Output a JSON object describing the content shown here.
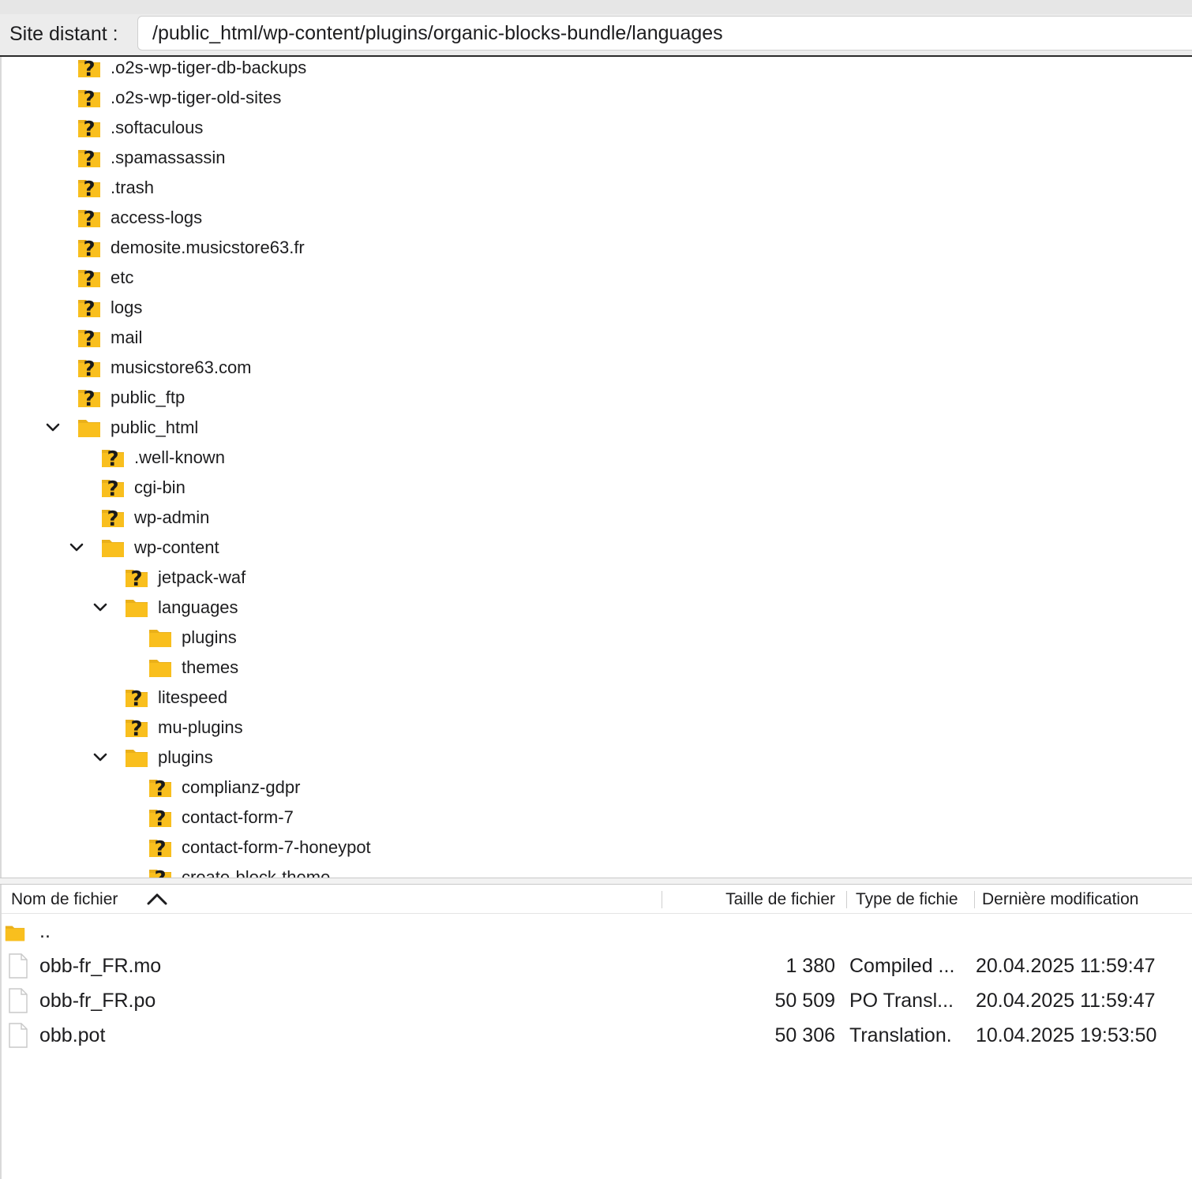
{
  "path_bar": {
    "label": "Site distant :",
    "path": "/public_html/wp-content/plugins/organic-blocks-bundle/languages"
  },
  "tree": [
    {
      "label": ".o2s-wp-tiger-db-backups",
      "level": 0,
      "icon": "unknown-folder-icon",
      "expanded": null
    },
    {
      "label": ".o2s-wp-tiger-old-sites",
      "level": 0,
      "icon": "unknown-folder-icon",
      "expanded": null
    },
    {
      "label": ".softaculous",
      "level": 0,
      "icon": "unknown-folder-icon",
      "expanded": null
    },
    {
      "label": ".spamassassin",
      "level": 0,
      "icon": "unknown-folder-icon",
      "expanded": null
    },
    {
      "label": ".trash",
      "level": 0,
      "icon": "unknown-folder-icon",
      "expanded": null
    },
    {
      "label": "access-logs",
      "level": 0,
      "icon": "unknown-folder-icon",
      "expanded": null
    },
    {
      "label": "demosite.musicstore63.fr",
      "level": 0,
      "icon": "unknown-folder-icon",
      "expanded": null
    },
    {
      "label": "etc",
      "level": 0,
      "icon": "unknown-folder-icon",
      "expanded": null
    },
    {
      "label": "logs",
      "level": 0,
      "icon": "unknown-folder-icon",
      "expanded": null
    },
    {
      "label": "mail",
      "level": 0,
      "icon": "unknown-folder-icon",
      "expanded": null
    },
    {
      "label": "musicstore63.com",
      "level": 0,
      "icon": "unknown-folder-icon",
      "expanded": null
    },
    {
      "label": "public_ftp",
      "level": 0,
      "icon": "unknown-folder-icon",
      "expanded": null
    },
    {
      "label": "public_html",
      "level": 0,
      "icon": "folder-icon",
      "expanded": true
    },
    {
      "label": ".well-known",
      "level": 1,
      "icon": "unknown-folder-icon",
      "expanded": null
    },
    {
      "label": "cgi-bin",
      "level": 1,
      "icon": "unknown-folder-icon",
      "expanded": null
    },
    {
      "label": "wp-admin",
      "level": 1,
      "icon": "unknown-folder-icon",
      "expanded": null
    },
    {
      "label": "wp-content",
      "level": 1,
      "icon": "folder-icon",
      "expanded": true
    },
    {
      "label": "jetpack-waf",
      "level": 2,
      "icon": "unknown-folder-icon",
      "expanded": null
    },
    {
      "label": "languages",
      "level": 2,
      "icon": "folder-icon",
      "expanded": true
    },
    {
      "label": "plugins",
      "level": 3,
      "icon": "folder-icon",
      "expanded": null
    },
    {
      "label": "themes",
      "level": 3,
      "icon": "folder-icon",
      "expanded": null
    },
    {
      "label": "litespeed",
      "level": 2,
      "icon": "unknown-folder-icon",
      "expanded": null
    },
    {
      "label": "mu-plugins",
      "level": 2,
      "icon": "unknown-folder-icon",
      "expanded": null
    },
    {
      "label": "plugins",
      "level": 2,
      "icon": "folder-icon",
      "expanded": true
    },
    {
      "label": "complianz-gdpr",
      "level": 3,
      "icon": "unknown-folder-icon",
      "expanded": null
    },
    {
      "label": "contact-form-7",
      "level": 3,
      "icon": "unknown-folder-icon",
      "expanded": null
    },
    {
      "label": "contact-form-7-honeypot",
      "level": 3,
      "icon": "unknown-folder-icon",
      "expanded": null
    },
    {
      "label": "create-block-theme",
      "level": 3,
      "icon": "unknown-folder-icon",
      "expanded": null
    }
  ],
  "file_list": {
    "columns": {
      "name": "Nom de fichier",
      "size": "Taille de fichier",
      "type": "Type de fichie",
      "modified": "Dernière modification"
    },
    "sort_icon": "chevron-up-icon",
    "rows": [
      {
        "name": "..",
        "size": "",
        "type": "",
        "modified": "",
        "icon": "folder-icon"
      },
      {
        "name": "obb-fr_FR.mo",
        "size": "1 380",
        "type": "Compiled ...",
        "modified": "20.04.2025 11:59:47",
        "icon": "file-icon"
      },
      {
        "name": "obb-fr_FR.po",
        "size": "50 509",
        "type": "PO Transl...",
        "modified": "20.04.2025 11:59:47",
        "icon": "file-icon"
      },
      {
        "name": "obb.pot",
        "size": "50 306",
        "type": "Translation.",
        "modified": "10.04.2025 19:53:50",
        "icon": "file-icon"
      }
    ]
  },
  "colors": {
    "folder": "#f9bf1e",
    "folder_dark": "#eab01a",
    "question_mark": "#1a1a1a",
    "text": "#1d1d1f"
  }
}
